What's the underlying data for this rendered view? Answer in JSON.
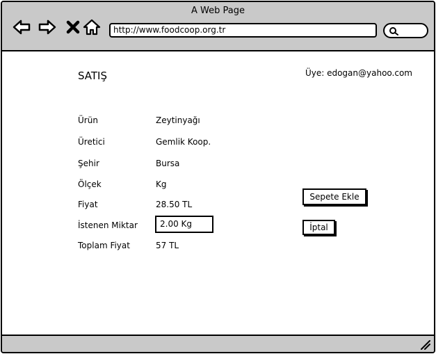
{
  "window": {
    "title": "A Web Page"
  },
  "browser": {
    "url": "http://www.foodcoop.org.tr",
    "icons": [
      "back-arrow-icon",
      "forward-arrow-icon",
      "close-icon",
      "home-icon",
      "search-icon",
      "resize-grip-icon"
    ]
  },
  "page": {
    "title": "SATIŞ",
    "member": "Üye: edogan@yahoo.com"
  },
  "form": {
    "rows": [
      {
        "label": "Ürün",
        "value": "Zeytinyağı"
      },
      {
        "label": "Üretici",
        "value": "Gemlik Koop."
      },
      {
        "label": "Şehir",
        "value": "Bursa"
      },
      {
        "label": "Ölçek",
        "value": "Kg"
      },
      {
        "label": "Fiyat",
        "value": "28.50 TL"
      },
      {
        "label": "İstenen Miktar",
        "value": "2.00 Kg"
      },
      {
        "label": "Toplam Fiyat",
        "value": "57 TL"
      }
    ]
  },
  "actions": {
    "add_to_cart": "Sepete Ekle",
    "cancel": "İptal"
  }
}
